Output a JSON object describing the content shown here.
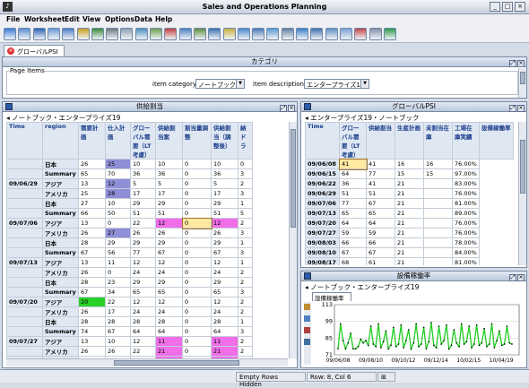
{
  "window": {
    "title": "Sales and Operations Planning",
    "min": "_",
    "max": "□",
    "close": "×"
  },
  "menu": [
    "File",
    "Worksheet",
    "Edit",
    "View",
    "Options",
    "Data",
    "Help"
  ],
  "toolbar_colors": [
    "#3a7bd5",
    "#5b8fd0",
    "#2a62b8",
    "#6a9ad8",
    "#4c7cc4",
    "#c8a020",
    "#3a8a3a",
    "#707880",
    "#90a0b0",
    "#4a90c0",
    "#6aa050",
    "#c04040",
    "#4a80c0",
    "#5a9040",
    "#3a70b0",
    "#c8b040",
    "#4a88c8",
    "#4a7ab8",
    "#5a9ad0",
    "#6080a0",
    "#3a80c8",
    "#4070b0",
    "#6090c0",
    "#7aa0d0",
    "#c04848",
    "#8090a8",
    "#2a9a4a"
  ],
  "tab": {
    "label": "グローバルPSI"
  },
  "category": {
    "title": "カテゴリ",
    "group_label": "Page Items",
    "item_category_label": "item category",
    "item_category_value": "ノートブック",
    "item_description_label": "item description",
    "item_description_value": "エンタープライズ19"
  },
  "demand": {
    "title": "供給割当",
    "crumb": "ノートブック・エンタープライズ19",
    "headers": [
      "Time",
      "region",
      "需要計画",
      "仕入計画",
      "グローバル需要（LT考慮）",
      "供給割当案",
      "割当量調整",
      "供給割当（調整後）",
      "納ドラ"
    ],
    "rows": [
      {
        "t": "",
        "r": "日本",
        "v": [
          "26",
          "25",
          "10",
          "10",
          "0",
          "10",
          "0"
        ],
        "c": [
          "",
          "b",
          "",
          "",
          "",
          "",
          ""
        ]
      },
      {
        "t": "",
        "r": "Summary",
        "v": [
          "65",
          "70",
          "36",
          "36",
          "0",
          "36",
          "3"
        ],
        "c": [
          "",
          "",
          "",
          "",
          "",
          "",
          ""
        ]
      },
      {
        "t": "09/06/29",
        "r": "アジア",
        "v": [
          "13",
          "12",
          "5",
          "5",
          "0",
          "5",
          "2"
        ],
        "c": [
          "",
          "b",
          "",
          "",
          "",
          "",
          ""
        ]
      },
      {
        "t": "",
        "r": "アメリカ",
        "v": [
          "25",
          "28",
          "17",
          "17",
          "0",
          "17",
          "3"
        ],
        "c": [
          "",
          "b",
          "",
          "",
          "",
          "",
          ""
        ]
      },
      {
        "t": "",
        "r": "日本",
        "v": [
          "27",
          "10",
          "29",
          "29",
          "0",
          "29",
          "1"
        ],
        "c": [
          "",
          "",
          "",
          "",
          "",
          "",
          ""
        ]
      },
      {
        "t": "",
        "r": "Summary",
        "v": [
          "66",
          "50",
          "51",
          "51",
          "0",
          "51",
          "5"
        ],
        "c": [
          "",
          "",
          "",
          "",
          "",
          "",
          ""
        ]
      },
      {
        "t": "09/07/06",
        "r": "アジア",
        "v": [
          "13",
          "0",
          "22",
          "12",
          "0",
          "12",
          "2"
        ],
        "c": [
          "",
          "",
          "",
          "p",
          "s",
          "p",
          ""
        ]
      },
      {
        "t": "",
        "r": "アメリカ",
        "v": [
          "26",
          "27",
          "26",
          "26",
          "0",
          "26",
          "3"
        ],
        "c": [
          "",
          "b",
          "",
          "",
          "",
          "",
          ""
        ]
      },
      {
        "t": "",
        "r": "日本",
        "v": [
          "28",
          "29",
          "29",
          "29",
          "0",
          "29",
          "1"
        ],
        "c": [
          "",
          "",
          "",
          "",
          "",
          "",
          ""
        ]
      },
      {
        "t": "",
        "r": "Summary",
        "v": [
          "67",
          "56",
          "77",
          "67",
          "0",
          "67",
          "3"
        ],
        "c": [
          "",
          "",
          "",
          "",
          "",
          "",
          ""
        ]
      },
      {
        "t": "09/07/13",
        "r": "アジア",
        "v": [
          "13",
          "11",
          "12",
          "12",
          "0",
          "12",
          "1"
        ],
        "c": [
          "",
          "",
          "",
          "",
          "",
          "",
          ""
        ]
      },
      {
        "t": "",
        "r": "アメリカ",
        "v": [
          "26",
          "0",
          "24",
          "24",
          "0",
          "24",
          "2"
        ],
        "c": [
          "",
          "",
          "",
          "",
          "",
          "",
          ""
        ]
      },
      {
        "t": "",
        "r": "日本",
        "v": [
          "28",
          "23",
          "29",
          "29",
          "0",
          "29",
          "2"
        ],
        "c": [
          "",
          "",
          "",
          "",
          "",
          "",
          ""
        ]
      },
      {
        "t": "",
        "r": "Summary",
        "v": [
          "67",
          "34",
          "65",
          "65",
          "0",
          "65",
          "3"
        ],
        "c": [
          "",
          "",
          "",
          "",
          "",
          "",
          ""
        ]
      },
      {
        "t": "09/07/20",
        "r": "アジア",
        "v": [
          "20",
          "22",
          "12",
          "12",
          "0",
          "12",
          "2"
        ],
        "c": [
          "g",
          "",
          "",
          "",
          "",
          "",
          ""
        ]
      },
      {
        "t": "",
        "r": "アメリカ",
        "v": [
          "26",
          "17",
          "24",
          "24",
          "0",
          "24",
          "2"
        ],
        "c": [
          "",
          "",
          "",
          "",
          "",
          "",
          ""
        ]
      },
      {
        "t": "",
        "r": "日本",
        "v": [
          "28",
          "28",
          "28",
          "28",
          "0",
          "28",
          "1"
        ],
        "c": [
          "",
          "",
          "",
          "",
          "",
          "",
          ""
        ]
      },
      {
        "t": "",
        "r": "Summary",
        "v": [
          "74",
          "67",
          "64",
          "64",
          "0",
          "64",
          "3"
        ],
        "c": [
          "",
          "",
          "",
          "",
          "",
          "",
          ""
        ]
      },
      {
        "t": "09/07/27",
        "r": "アジア",
        "v": [
          "13",
          "10",
          "12",
          "11",
          "0",
          "11",
          "2"
        ],
        "c": [
          "",
          "",
          "",
          "p",
          "",
          "p",
          ""
        ]
      },
      {
        "t": "",
        "r": "アメリカ",
        "v": [
          "26",
          "26",
          "22",
          "21",
          "0",
          "21",
          "2"
        ],
        "c": [
          "",
          "",
          "",
          "p",
          "",
          "p",
          ""
        ]
      },
      {
        "t": "",
        "r": "日本",
        "v": [
          "28",
          "28",
          "30",
          "27",
          "0",
          "27",
          "3"
        ],
        "c": [
          "",
          "",
          "",
          "p",
          "",
          "p",
          ""
        ]
      },
      {
        "t": "",
        "r": "Summary",
        "v": [
          "67",
          "64",
          "64",
          "59",
          "0",
          "59",
          "2"
        ],
        "c": [
          "",
          "",
          "",
          "",
          "",
          "",
          ""
        ]
      }
    ]
  },
  "psi": {
    "title": "グローバルPSI",
    "crumb": "エンタープライズ19・ノートブック",
    "headers": [
      "Time",
      "グローバル需要（LT考慮）",
      "供給割当",
      "生産計画",
      "未割当在庫",
      "工場在庫実績",
      "設備稼働率"
    ],
    "rows": [
      {
        "t": "09/06/08",
        "v": [
          "41",
          "41",
          "16",
          "16",
          "76.00%"
        ],
        "sel": true
      },
      {
        "t": "09/06/15",
        "v": [
          "64",
          "77",
          "15",
          "15",
          "97.00%"
        ]
      },
      {
        "t": "09/06/22",
        "v": [
          "36",
          "41",
          "21",
          "",
          "83.00%"
        ]
      },
      {
        "t": "09/06/29",
        "v": [
          "51",
          "51",
          "21",
          "",
          "76.00%"
        ]
      },
      {
        "t": "09/07/06",
        "v": [
          "77",
          "67",
          "21",
          "",
          "81.00%"
        ]
      },
      {
        "t": "09/07/13",
        "v": [
          "65",
          "65",
          "21",
          "",
          "89.00%"
        ]
      },
      {
        "t": "09/07/20",
        "v": [
          "64",
          "64",
          "21",
          "",
          "76.00%"
        ]
      },
      {
        "t": "09/07/27",
        "v": [
          "59",
          "59",
          "21",
          "",
          "76.00%"
        ]
      },
      {
        "t": "09/08/03",
        "v": [
          "66",
          "66",
          "21",
          "",
          "78.00%"
        ]
      },
      {
        "t": "09/08/10",
        "v": [
          "67",
          "67",
          "21",
          "",
          "84.00%"
        ]
      },
      {
        "t": "09/08/17",
        "v": [
          "68",
          "61",
          "21",
          "",
          "81.00%"
        ]
      },
      {
        "t": "09/08/24",
        "v": [
          "65",
          "61",
          "21",
          "",
          "83.00%"
        ]
      },
      {
        "t": "09/08/31",
        "v": [
          "61",
          "61",
          "",
          "",
          ""
        ]
      }
    ]
  },
  "util": {
    "title": "設備稼働率",
    "crumb": "ノートブック・エンタープライズ19",
    "tab": "設備稼働率",
    "y_ticks": [
      "113",
      "99",
      "85",
      "71"
    ],
    "x_ticks": [
      "09/06/08",
      "09/08/10",
      "09/10/12",
      "09/12/14",
      "10/02/15",
      "10/04/19"
    ]
  },
  "chart_data": {
    "type": "line",
    "title": "",
    "ylim": [
      71,
      113
    ],
    "x_ticks": [
      "09/06/08",
      "09/08/10",
      "09/10/12",
      "09/12/14",
      "10/02/15",
      "10/04/19"
    ],
    "series": [
      {
        "values": [
          76,
          97,
          83,
          76,
          81,
          89,
          76,
          76,
          78,
          84,
          81,
          83,
          79,
          95,
          80,
          78,
          97,
          77,
          82,
          91,
          76,
          79,
          94,
          78,
          80,
          96,
          77,
          83,
          92,
          76,
          81,
          97,
          78,
          80,
          94,
          76,
          82,
          98,
          79,
          77,
          95,
          80,
          83,
          96,
          76,
          79,
          92,
          81,
          78,
          97,
          80,
          82,
          95,
          77,
          80,
          96,
          79,
          81,
          93,
          78,
          80,
          97,
          77,
          83,
          91,
          79,
          80,
          95,
          81,
          80
        ]
      }
    ],
    "line_color": "#22cc22",
    "marker_color": "#000000"
  },
  "status": {
    "empty_rows": "Empty Rows Hidden",
    "position": "Row: 8, Col 6"
  }
}
